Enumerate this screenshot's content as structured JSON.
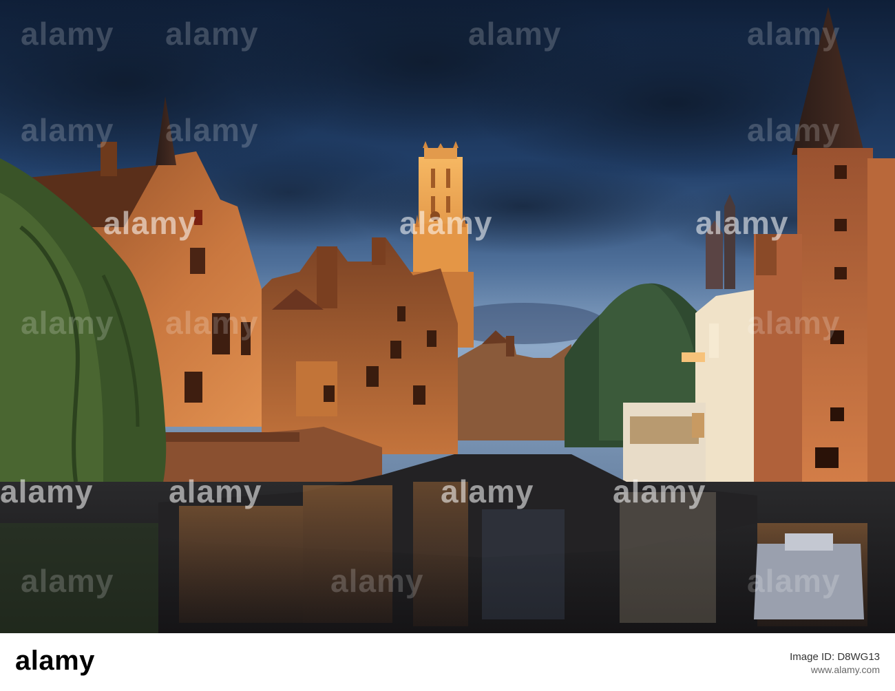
{
  "watermark": {
    "brand": "alamy"
  },
  "footer": {
    "logo": "alamy",
    "image_id_label": "Image ID:",
    "image_id": "D8WG13",
    "url": "www.alamy.com"
  },
  "colors": {
    "sky_top": "#0f1f38",
    "sky_mid": "#2d4a70",
    "sky_horizon": "#8ea9c8",
    "brick_lit": "#c9773f",
    "brick_dark": "#6e3a1c",
    "belfry_glow": "#f4a955",
    "water": "#1e1d1e",
    "willow": "#3f5a2c"
  }
}
